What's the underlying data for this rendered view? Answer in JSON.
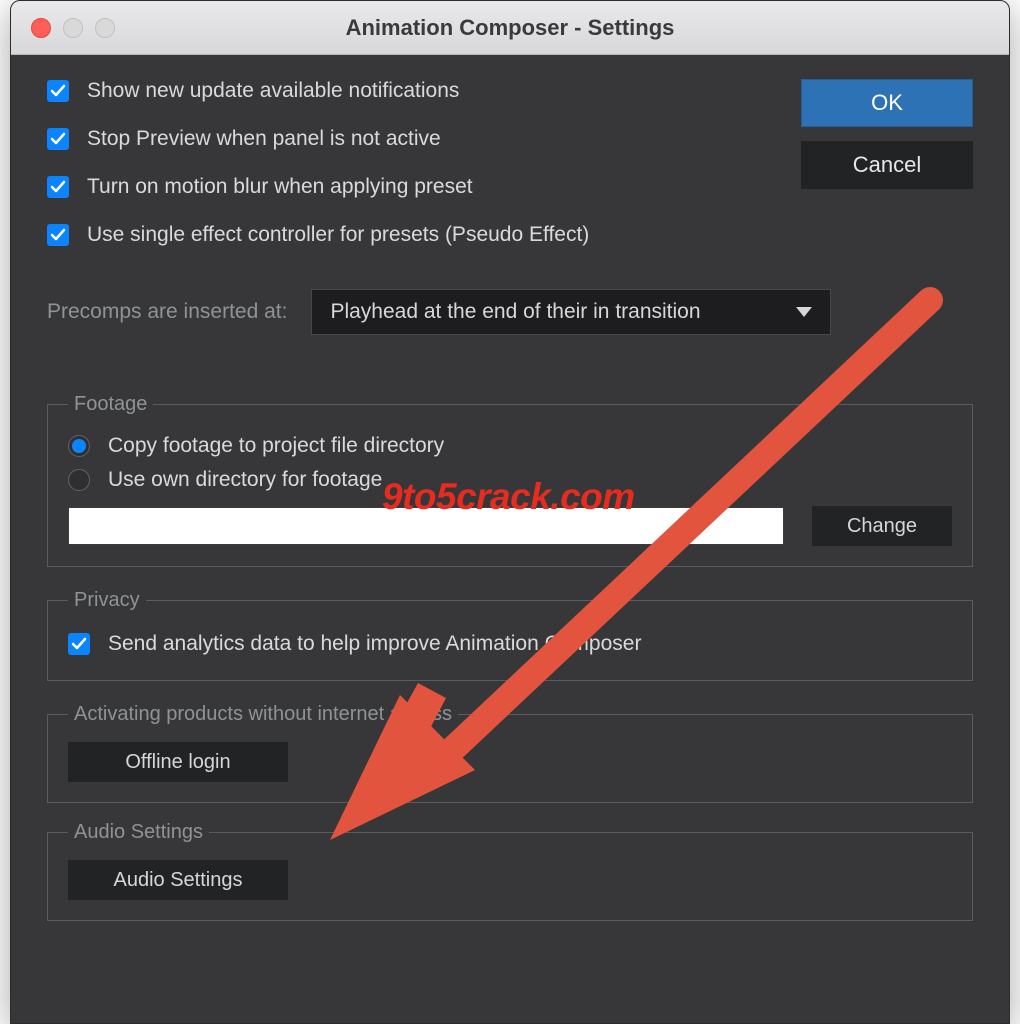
{
  "window": {
    "title": "Animation Composer - Settings"
  },
  "checkboxes": {
    "updates": "Show new update available notifications",
    "stop_preview": "Stop Preview when panel is not active",
    "motion_blur": "Turn on motion blur when applying preset",
    "pseudo": "Use single effect controller for presets (Pseudo Effect)"
  },
  "precomps": {
    "label": "Precomps are inserted at:",
    "selected": "Playhead at the end of their in transition"
  },
  "footage": {
    "legend": "Footage",
    "copy": "Copy footage to project file directory",
    "own": "Use own directory for footage",
    "path": "",
    "change": "Change"
  },
  "privacy": {
    "legend": "Privacy",
    "analytics": "Send analytics data to help improve Animation Composer"
  },
  "activation": {
    "legend": "Activating products without internet access",
    "offline": "Offline login"
  },
  "audio": {
    "legend": "Audio Settings",
    "button": "Audio Settings"
  },
  "buttons": {
    "ok": "OK",
    "cancel": "Cancel"
  },
  "overlay": {
    "watermark": "9to5crack.com"
  }
}
